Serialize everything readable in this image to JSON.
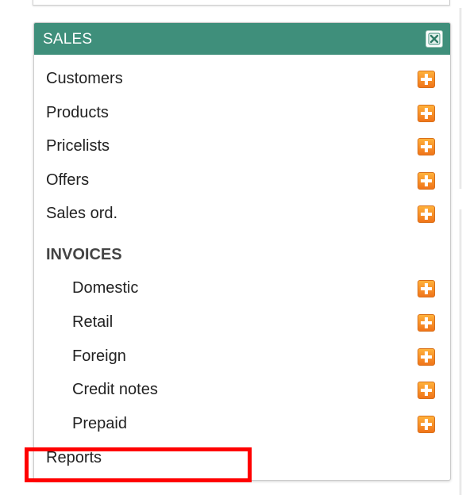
{
  "panel": {
    "title": "SALES",
    "close_icon": "close-icon",
    "items": [
      {
        "label": "Customers",
        "icon": "plus-icon"
      },
      {
        "label": "Products",
        "icon": "plus-icon"
      },
      {
        "label": "Pricelists",
        "icon": "plus-icon"
      },
      {
        "label": "Offers",
        "icon": "plus-icon"
      },
      {
        "label": "Sales ord.",
        "icon": "plus-icon"
      }
    ],
    "invoices": {
      "header": "INVOICES",
      "items": [
        {
          "label": "Domestic",
          "icon": "plus-icon"
        },
        {
          "label": "Retail",
          "icon": "plus-icon"
        },
        {
          "label": "Foreign",
          "icon": "plus-icon"
        },
        {
          "label": "Credit notes",
          "icon": "plus-icon"
        },
        {
          "label": "Prepaid",
          "icon": "plus-icon"
        }
      ]
    },
    "reports_label": "Reports"
  },
  "colors": {
    "header_bg": "#3f8f7b",
    "plus_icon": "#f0741a",
    "highlight": "#ff0000"
  }
}
